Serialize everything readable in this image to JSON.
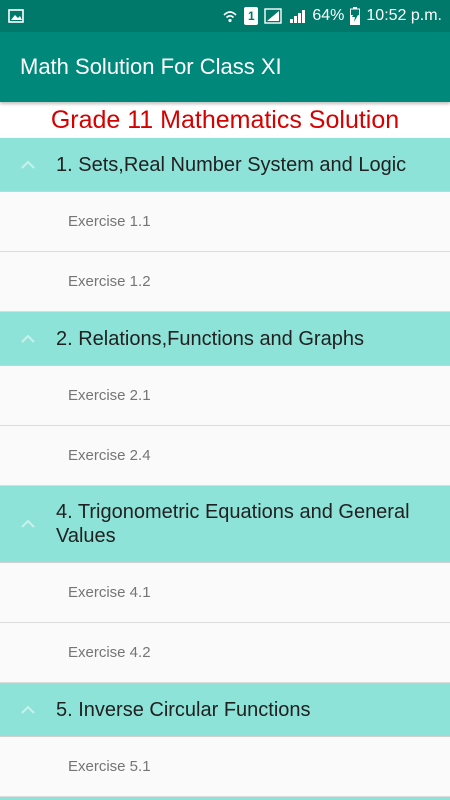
{
  "status_bar": {
    "battery": "64%",
    "time": "10:52 p.m.",
    "sim_label": "1"
  },
  "app_bar": {
    "title": "Math Solution For Class XI"
  },
  "heading": "Grade 11 Mathematics Solution",
  "colors": {
    "status_bar": "#00796b",
    "app_bar": "#00897b",
    "group_header": "#8ee3d9",
    "heading_text": "#d50000"
  },
  "groups": [
    {
      "title": "1. Sets,Real Number System and Logic",
      "items": [
        "Exercise 1.1",
        "Exercise 1.2"
      ]
    },
    {
      "title": "2. Relations,Functions and Graphs",
      "items": [
        "Exercise 2.1",
        "Exercise 2.4"
      ]
    },
    {
      "title": "4. Trigonometric Equations and General Values",
      "items": [
        "Exercise 4.1",
        "Exercise 4.2"
      ]
    },
    {
      "title": "5. Inverse Circular Functions",
      "items": [
        "Exercise 5.1"
      ]
    }
  ]
}
